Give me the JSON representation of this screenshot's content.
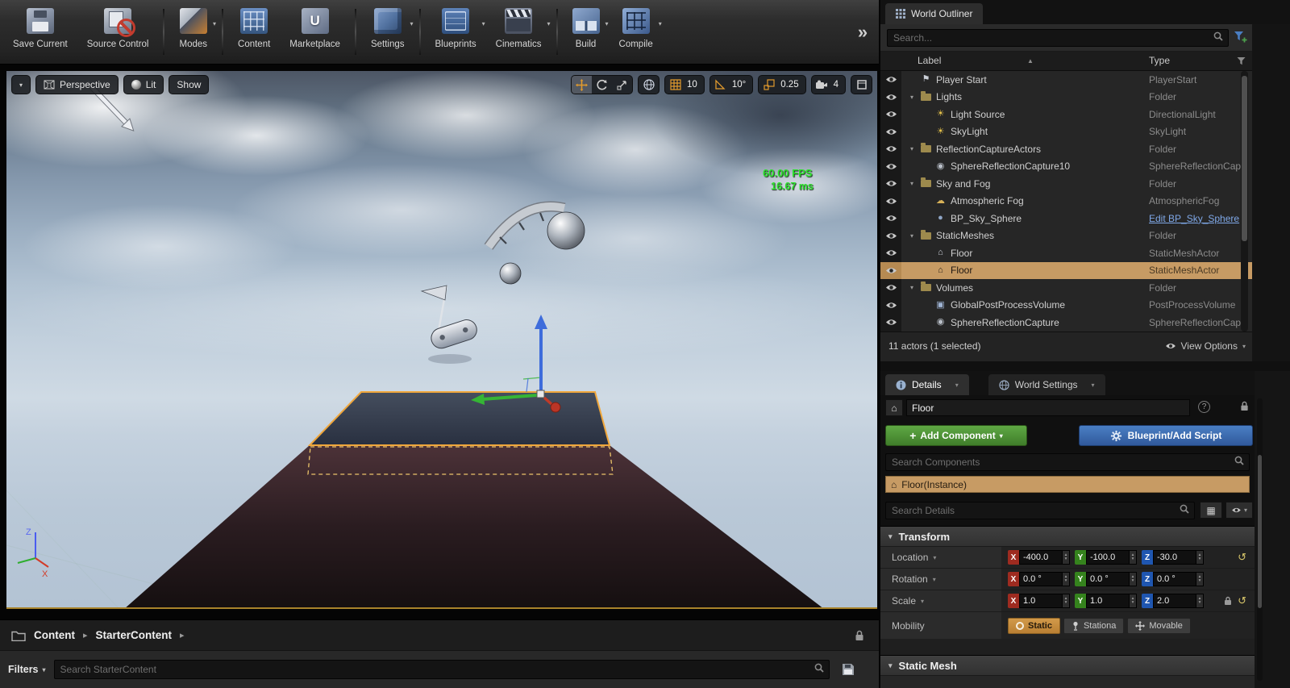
{
  "toolbar": {
    "buttons": [
      {
        "label": "Save Current",
        "icon": "save-icon",
        "dropdown": false,
        "group_end": false
      },
      {
        "label": "Source Control",
        "icon": "source-control-icon",
        "dropdown": false,
        "group_end": true
      },
      {
        "label": "Modes",
        "icon": "modes-icon",
        "dropdown": true,
        "group_end": true
      },
      {
        "label": "Content",
        "icon": "content-icon",
        "dropdown": false,
        "group_end": false
      },
      {
        "label": "Marketplace",
        "icon": "marketplace-icon",
        "dropdown": false,
        "group_end": true
      },
      {
        "label": "Settings",
        "icon": "settings-icon",
        "dropdown": true,
        "group_end": true
      },
      {
        "label": "Blueprints",
        "icon": "blueprints-icon",
        "dropdown": true,
        "group_end": false
      },
      {
        "label": "Cinematics",
        "icon": "cinematics-icon",
        "dropdown": true,
        "group_end": true
      },
      {
        "label": "Build",
        "icon": "build-icon",
        "dropdown": true,
        "group_end": false
      },
      {
        "label": "Compile",
        "icon": "compile-icon",
        "dropdown": true,
        "group_end": false
      }
    ],
    "overflow_chevron": "»"
  },
  "viewport": {
    "perspective_label": "Perspective",
    "lit_label": "Lit",
    "show_label": "Show",
    "snap_grid_value": "10",
    "snap_rotation_value": "10°",
    "snap_scale_value": "0.25",
    "camera_speed_value": "4",
    "fps_text": "60.00 FPS",
    "frame_time_text": "16.67 ms",
    "fps_color": "#2ee22e",
    "axis_z_label": "Z",
    "axis_x_label": "X"
  },
  "outliner": {
    "tab_title": "World Outliner",
    "search_placeholder": "Search...",
    "columns": {
      "label": "Label",
      "type": "Type"
    },
    "rows": [
      {
        "label": "Player Start",
        "type": "PlayerStart",
        "icon": "player-start-icon",
        "glyph": "⚑",
        "icon_color": "#c9ced6",
        "indent": 1,
        "expander": false,
        "selected": false,
        "type_link": false
      },
      {
        "label": "Lights",
        "type": "Folder",
        "icon": "folder-icon",
        "glyph": "",
        "icon_color": "",
        "indent": 1,
        "expander": true,
        "selected": false,
        "type_link": false
      },
      {
        "label": "Light Source",
        "type": "DirectionalLight",
        "icon": "directional-light-icon",
        "glyph": "☀",
        "icon_color": "#e3c04a",
        "indent": 2,
        "expander": false,
        "selected": false,
        "type_link": false
      },
      {
        "label": "SkyLight",
        "type": "SkyLight",
        "icon": "sky-light-icon",
        "glyph": "☀",
        "icon_color": "#e3c04a",
        "indent": 2,
        "expander": false,
        "selected": false,
        "type_link": false
      },
      {
        "label": "ReflectionCaptureActors",
        "type": "Folder",
        "icon": "folder-icon",
        "glyph": "",
        "icon_color": "",
        "indent": 1,
        "expander": true,
        "selected": false,
        "type_link": false
      },
      {
        "label": "SphereReflectionCapture10",
        "type": "SphereReflectionCapture",
        "icon": "sphere-reflection-icon",
        "glyph": "◉",
        "icon_color": "#b9bfc8",
        "indent": 2,
        "expander": false,
        "selected": false,
        "type_link": false
      },
      {
        "label": "Sky and Fog",
        "type": "Folder",
        "icon": "folder-icon",
        "glyph": "",
        "icon_color": "",
        "indent": 1,
        "expander": true,
        "selected": false,
        "type_link": false
      },
      {
        "label": "Atmospheric Fog",
        "type": "AtmosphericFog",
        "icon": "atmospheric-fog-icon",
        "glyph": "☁",
        "icon_color": "#d8b258",
        "indent": 2,
        "expander": false,
        "selected": false,
        "type_link": false
      },
      {
        "label": "BP_Sky_Sphere",
        "type": "Edit BP_Sky_Sphere",
        "icon": "sky-sphere-icon",
        "glyph": "●",
        "icon_color": "#8fa6c6",
        "indent": 2,
        "expander": false,
        "selected": false,
        "type_link": true
      },
      {
        "label": "StaticMeshes",
        "type": "Folder",
        "icon": "folder-icon",
        "glyph": "",
        "icon_color": "",
        "indent": 1,
        "expander": true,
        "selected": false,
        "type_link": false
      },
      {
        "label": "Floor",
        "type": "StaticMeshActor",
        "icon": "static-mesh-icon",
        "glyph": "⌂",
        "icon_color": "#c9ced6",
        "indent": 2,
        "expander": false,
        "selected": false,
        "type_link": false
      },
      {
        "label": "Floor",
        "type": "StaticMeshActor",
        "icon": "static-mesh-icon",
        "glyph": "⌂",
        "icon_color": "#2a2118",
        "indent": 2,
        "expander": false,
        "selected": true,
        "type_link": false
      },
      {
        "label": "Volumes",
        "type": "Folder",
        "icon": "folder-icon",
        "glyph": "",
        "icon_color": "",
        "indent": 1,
        "expander": true,
        "selected": false,
        "type_link": false
      },
      {
        "label": "GlobalPostProcessVolume",
        "type": "PostProcessVolume",
        "icon": "post-process-volume-icon",
        "glyph": "▣",
        "icon_color": "#9fb4d4",
        "indent": 2,
        "expander": false,
        "selected": false,
        "type_link": false
      },
      {
        "label": "SphereReflectionCapture",
        "type": "SphereReflectionCapture",
        "icon": "sphere-reflection-icon",
        "glyph": "◉",
        "icon_color": "#b9bfc8",
        "indent": 2,
        "expander": false,
        "selected": false,
        "type_link": false
      }
    ],
    "footer_status": "11 actors (1 selected)",
    "view_options_label": "View Options"
  },
  "details": {
    "tab_details": "Details",
    "tab_world_settings": "World Settings",
    "actor_name": "Floor",
    "add_component_label": "Add Component",
    "blueprint_label": "Blueprint/Add Script",
    "search_components_placeholder": "Search Components",
    "component_row": "Floor(Instance)",
    "search_details_placeholder": "Search Details",
    "transform": {
      "section_title": "Transform",
      "rows": [
        {
          "label": "Location",
          "x": "-400.0",
          "y": "-100.0",
          "z": "-30.0",
          "has_reset": true,
          "has_lock": false
        },
        {
          "label": "Rotation",
          "x": "0.0 °",
          "y": "0.0 °",
          "z": "0.0 °",
          "has_reset": false,
          "has_lock": false
        },
        {
          "label": "Scale",
          "x": "1.0",
          "y": "1.0",
          "z": "2.0",
          "has_reset": true,
          "has_lock": true
        }
      ],
      "axis_colors": {
        "x": "#9e2b20",
        "y": "#35831d",
        "z": "#1f56b0"
      },
      "mobility_label": "Mobility",
      "mobility_options": [
        {
          "label": "Static",
          "selected": true
        },
        {
          "label": "Stationa",
          "selected": false
        },
        {
          "label": "Movable",
          "selected": false
        }
      ]
    },
    "static_mesh_section_title": "Static Mesh",
    "selection_color": "#c79b64"
  },
  "content_browser": {
    "breadcrumb": [
      {
        "label": "Content"
      },
      {
        "label": "StarterContent"
      }
    ],
    "filters_label": "Filters",
    "search_placeholder": "Search StarterContent"
  }
}
